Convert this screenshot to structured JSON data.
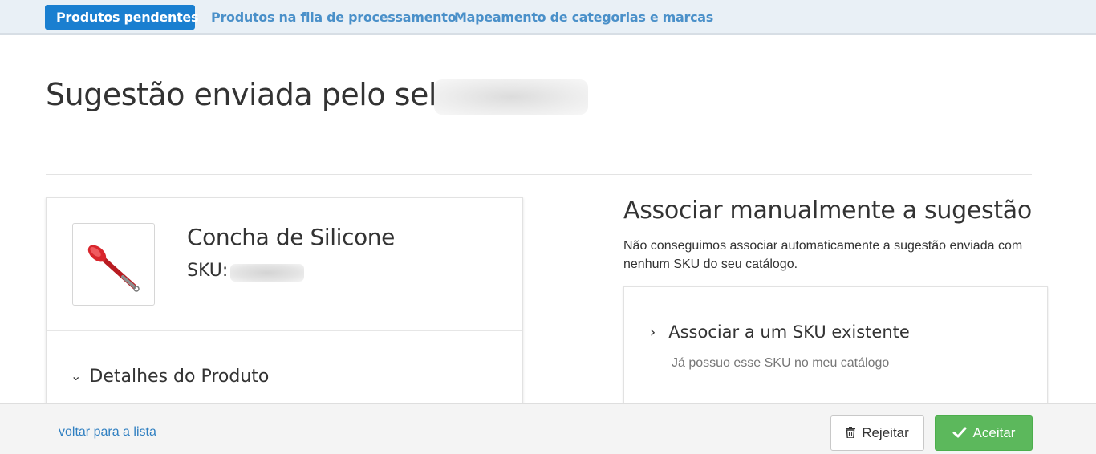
{
  "tabs": [
    {
      "label": "Produtos pendentes",
      "active": true
    },
    {
      "label": "Produtos na fila de processamento",
      "active": false
    },
    {
      "label": "Mapeamento de categorias e marcas",
      "active": false
    }
  ],
  "page": {
    "title": "Sugestão enviada pelo seller",
    "seller_name_blurred": true
  },
  "product": {
    "name": "Concha de Silicone",
    "sku_label": "SKU:",
    "sku_value_blurred": true,
    "image_icon": "silicone-ladle-icon",
    "details_toggle": "Detalhes do Produto"
  },
  "association": {
    "title": "Associar manualmente a sugestão",
    "description": "Não conseguimos associar automaticamente a sugestão enviada com nenhum SKU do seu catálogo.",
    "option_label": "Associar a um SKU existente",
    "option_sub": "Já possuo esse SKU no meu catálogo"
  },
  "footer": {
    "back_link": "voltar para a lista",
    "reject_label": "Rejeitar",
    "accept_label": "Aceitar"
  },
  "colors": {
    "accent_blue": "#1a7fd0",
    "link_blue": "#2f7fc1",
    "accept_green": "#5cb85c",
    "topbar_bg": "#e9f0f6"
  }
}
